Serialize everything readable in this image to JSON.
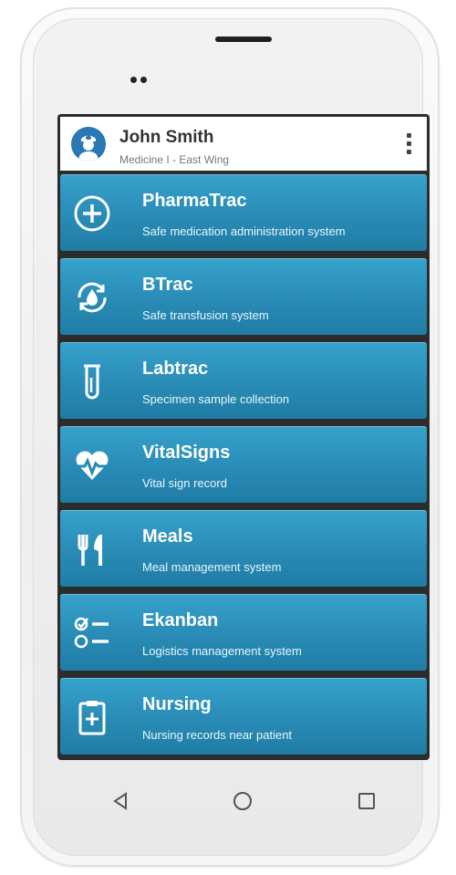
{
  "header": {
    "user_name": "John Smith",
    "location": "Medicine I - East Wing",
    "icons": {
      "avatar": "nurse-avatar-icon",
      "menu": "more-vertical-icon"
    }
  },
  "apps": [
    {
      "title": "PharmaTrac",
      "subtitle": "Safe medication administration system",
      "icon": "plus-circle-icon"
    },
    {
      "title": "BTrac",
      "subtitle": "Safe transfusion system",
      "icon": "blood-drop-cycle-icon"
    },
    {
      "title": "Labtrac",
      "subtitle": "Specimen sample collection",
      "icon": "test-tube-icon"
    },
    {
      "title": "VitalSigns",
      "subtitle": "Vital sign record",
      "icon": "heart-pulse-icon"
    },
    {
      "title": "Meals",
      "subtitle": "Meal management system",
      "icon": "fork-knife-icon"
    },
    {
      "title": "Ekanban",
      "subtitle": "Logistics management system",
      "icon": "checklist-icon"
    },
    {
      "title": "Nursing",
      "subtitle": "Nursing records near patient",
      "icon": "clipboard-plus-icon"
    }
  ],
  "navbar": {
    "icons": [
      "back-icon",
      "home-icon",
      "recent-apps-icon"
    ]
  },
  "colors": {
    "tile_top": "#36a3cc",
    "tile_bottom": "#1f7ca5",
    "avatar": "#2a79b4",
    "bezel": "#2c2c2c"
  }
}
